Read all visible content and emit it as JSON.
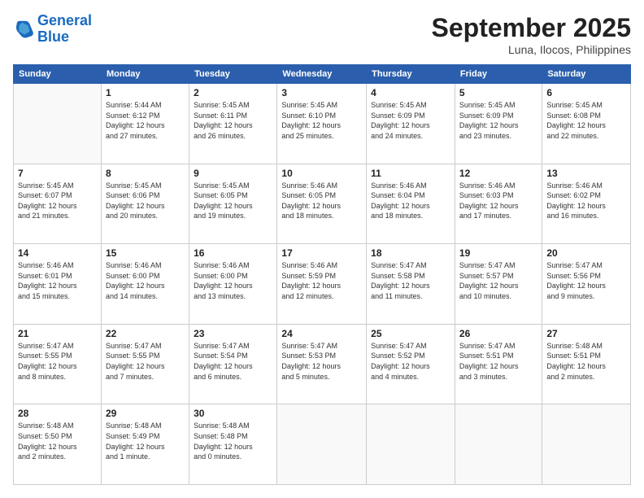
{
  "header": {
    "logo_line1": "General",
    "logo_line2": "Blue",
    "month_year": "September 2025",
    "location": "Luna, Ilocos, Philippines"
  },
  "weekdays": [
    "Sunday",
    "Monday",
    "Tuesday",
    "Wednesday",
    "Thursday",
    "Friday",
    "Saturday"
  ],
  "weeks": [
    [
      {
        "day": "",
        "info": ""
      },
      {
        "day": "1",
        "info": "Sunrise: 5:44 AM\nSunset: 6:12 PM\nDaylight: 12 hours\nand 27 minutes."
      },
      {
        "day": "2",
        "info": "Sunrise: 5:45 AM\nSunset: 6:11 PM\nDaylight: 12 hours\nand 26 minutes."
      },
      {
        "day": "3",
        "info": "Sunrise: 5:45 AM\nSunset: 6:10 PM\nDaylight: 12 hours\nand 25 minutes."
      },
      {
        "day": "4",
        "info": "Sunrise: 5:45 AM\nSunset: 6:09 PM\nDaylight: 12 hours\nand 24 minutes."
      },
      {
        "day": "5",
        "info": "Sunrise: 5:45 AM\nSunset: 6:09 PM\nDaylight: 12 hours\nand 23 minutes."
      },
      {
        "day": "6",
        "info": "Sunrise: 5:45 AM\nSunset: 6:08 PM\nDaylight: 12 hours\nand 22 minutes."
      }
    ],
    [
      {
        "day": "7",
        "info": "Sunrise: 5:45 AM\nSunset: 6:07 PM\nDaylight: 12 hours\nand 21 minutes."
      },
      {
        "day": "8",
        "info": "Sunrise: 5:45 AM\nSunset: 6:06 PM\nDaylight: 12 hours\nand 20 minutes."
      },
      {
        "day": "9",
        "info": "Sunrise: 5:45 AM\nSunset: 6:05 PM\nDaylight: 12 hours\nand 19 minutes."
      },
      {
        "day": "10",
        "info": "Sunrise: 5:46 AM\nSunset: 6:05 PM\nDaylight: 12 hours\nand 18 minutes."
      },
      {
        "day": "11",
        "info": "Sunrise: 5:46 AM\nSunset: 6:04 PM\nDaylight: 12 hours\nand 18 minutes."
      },
      {
        "day": "12",
        "info": "Sunrise: 5:46 AM\nSunset: 6:03 PM\nDaylight: 12 hours\nand 17 minutes."
      },
      {
        "day": "13",
        "info": "Sunrise: 5:46 AM\nSunset: 6:02 PM\nDaylight: 12 hours\nand 16 minutes."
      }
    ],
    [
      {
        "day": "14",
        "info": "Sunrise: 5:46 AM\nSunset: 6:01 PM\nDaylight: 12 hours\nand 15 minutes."
      },
      {
        "day": "15",
        "info": "Sunrise: 5:46 AM\nSunset: 6:00 PM\nDaylight: 12 hours\nand 14 minutes."
      },
      {
        "day": "16",
        "info": "Sunrise: 5:46 AM\nSunset: 6:00 PM\nDaylight: 12 hours\nand 13 minutes."
      },
      {
        "day": "17",
        "info": "Sunrise: 5:46 AM\nSunset: 5:59 PM\nDaylight: 12 hours\nand 12 minutes."
      },
      {
        "day": "18",
        "info": "Sunrise: 5:47 AM\nSunset: 5:58 PM\nDaylight: 12 hours\nand 11 minutes."
      },
      {
        "day": "19",
        "info": "Sunrise: 5:47 AM\nSunset: 5:57 PM\nDaylight: 12 hours\nand 10 minutes."
      },
      {
        "day": "20",
        "info": "Sunrise: 5:47 AM\nSunset: 5:56 PM\nDaylight: 12 hours\nand 9 minutes."
      }
    ],
    [
      {
        "day": "21",
        "info": "Sunrise: 5:47 AM\nSunset: 5:55 PM\nDaylight: 12 hours\nand 8 minutes."
      },
      {
        "day": "22",
        "info": "Sunrise: 5:47 AM\nSunset: 5:55 PM\nDaylight: 12 hours\nand 7 minutes."
      },
      {
        "day": "23",
        "info": "Sunrise: 5:47 AM\nSunset: 5:54 PM\nDaylight: 12 hours\nand 6 minutes."
      },
      {
        "day": "24",
        "info": "Sunrise: 5:47 AM\nSunset: 5:53 PM\nDaylight: 12 hours\nand 5 minutes."
      },
      {
        "day": "25",
        "info": "Sunrise: 5:47 AM\nSunset: 5:52 PM\nDaylight: 12 hours\nand 4 minutes."
      },
      {
        "day": "26",
        "info": "Sunrise: 5:47 AM\nSunset: 5:51 PM\nDaylight: 12 hours\nand 3 minutes."
      },
      {
        "day": "27",
        "info": "Sunrise: 5:48 AM\nSunset: 5:51 PM\nDaylight: 12 hours\nand 2 minutes."
      }
    ],
    [
      {
        "day": "28",
        "info": "Sunrise: 5:48 AM\nSunset: 5:50 PM\nDaylight: 12 hours\nand 2 minutes."
      },
      {
        "day": "29",
        "info": "Sunrise: 5:48 AM\nSunset: 5:49 PM\nDaylight: 12 hours\nand 1 minute."
      },
      {
        "day": "30",
        "info": "Sunrise: 5:48 AM\nSunset: 5:48 PM\nDaylight: 12 hours\nand 0 minutes."
      },
      {
        "day": "",
        "info": ""
      },
      {
        "day": "",
        "info": ""
      },
      {
        "day": "",
        "info": ""
      },
      {
        "day": "",
        "info": ""
      }
    ]
  ]
}
